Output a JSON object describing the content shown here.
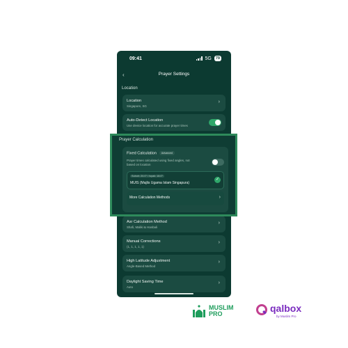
{
  "status_bar": {
    "time": "09:41",
    "network": "5G",
    "battery": "79"
  },
  "header": {
    "title": "Prayer Settings"
  },
  "sections": {
    "location": "Location",
    "prayer_calculation": "Prayer Calculation"
  },
  "location_card": {
    "title": "Location",
    "subtitle": "Singapore, SG"
  },
  "auto_detect": {
    "title": "Auto-Detect Location",
    "subtitle": "Use device location for accurate prayer times",
    "enabled": true
  },
  "fixed_calc": {
    "title": "Fixed Calculation",
    "badge": "Advanced",
    "description_line1": "Prayer times calculated using fixed angles, not",
    "description_line2": "based on location",
    "enabled": false
  },
  "selected_method": {
    "angles": "Subuh: 20.0° / Isyak: 18.0°",
    "name": "MUIS (Majlis Ugama Islam Singapura)"
  },
  "more_methods": {
    "label": "More Calculation Methods"
  },
  "asr_method": {
    "title": "Asr Calculation Method",
    "subtitle": "Shafi, Maliki & Hanbali"
  },
  "manual_corrections": {
    "title": "Manual Corrections",
    "subtitle": "(1, 1, 1, 1, 1)"
  },
  "high_latitude": {
    "title": "High Latitude Adjustment",
    "subtitle": "Angle-Based Method"
  },
  "daylight_saving": {
    "title": "Daylight Saving Time",
    "subtitle": "Auto"
  },
  "brand": {
    "muslim_pro": "MUSLIM",
    "muslim_pro_2": "PRO",
    "qalbox": "qalbox",
    "qalbox_by": "by Muslim Pro"
  },
  "colors": {
    "background": "#0c3a31",
    "card": "#1b4b41",
    "accent": "#2fa66a",
    "highlight_border": "#2e8a5b"
  }
}
